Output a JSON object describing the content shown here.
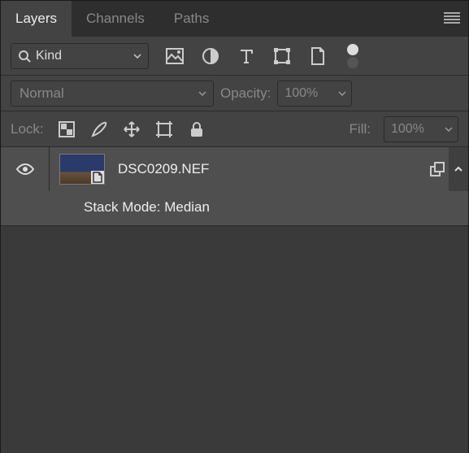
{
  "tabs": {
    "layers": "Layers",
    "channels": "Channels",
    "paths": "Paths"
  },
  "filter": {
    "kind_label": "Kind"
  },
  "blend": {
    "mode": "Normal",
    "opacity_label": "Opacity:",
    "opacity_value": "100%"
  },
  "lock": {
    "label": "Lock:",
    "fill_label": "Fill:",
    "fill_value": "100%"
  },
  "layer": {
    "name": "DSC0209.NEF",
    "sub": "Stack Mode: Median"
  }
}
